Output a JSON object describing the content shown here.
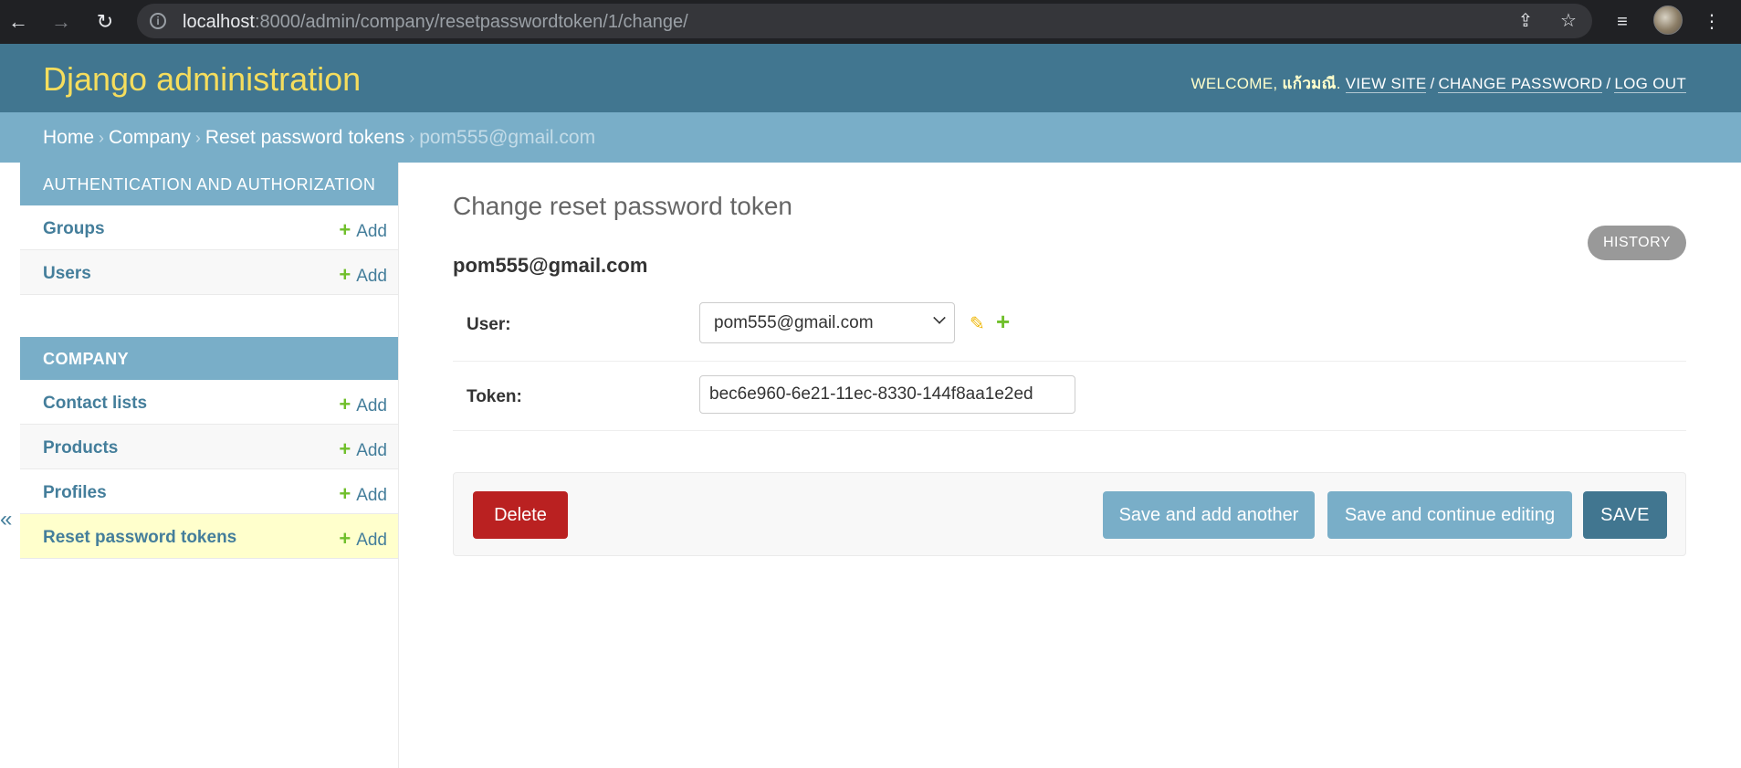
{
  "browser": {
    "url_host": "localhost",
    "url_rest": ":8000/admin/company/resetpasswordtoken/1/change/"
  },
  "header": {
    "branding": "Django administration",
    "welcome": "Welcome,",
    "username": "แก้วมณี",
    "view_site": "View site",
    "change_password": "Change password",
    "log_out": "Log out"
  },
  "breadcrumbs": {
    "home": "Home",
    "company": "Company",
    "model": "Reset password tokens",
    "current": "pom555@gmail.com"
  },
  "sidebar": {
    "toggle": "«",
    "add_label": "Add",
    "auth_caption": "Authentication and Authorization",
    "auth_items": [
      "Groups",
      "Users"
    ],
    "company_caption": "Company",
    "company_items": [
      "Contact lists",
      "Products",
      "Profiles",
      "Reset password tokens"
    ]
  },
  "content": {
    "title": "Change reset password token",
    "history": "History",
    "object": "pom555@gmail.com",
    "user_label": "User:",
    "user_value": "pom555@gmail.com",
    "token_label": "Token:",
    "token_value": "bec6e960-6e21-11ec-8330-144f8aa1e2ed"
  },
  "actions": {
    "delete": "Delete",
    "save_add_another": "Save and add another",
    "save_continue": "Save and continue editing",
    "save": "Save"
  },
  "colors": {
    "header_bg": "#417690",
    "branding": "#f5dd5d",
    "breadcrumbs_bg": "#79aec8",
    "link": "#447e9b",
    "add_green": "#70bf2b",
    "delete_red": "#ba2121",
    "current_row": "#ffffcc"
  }
}
